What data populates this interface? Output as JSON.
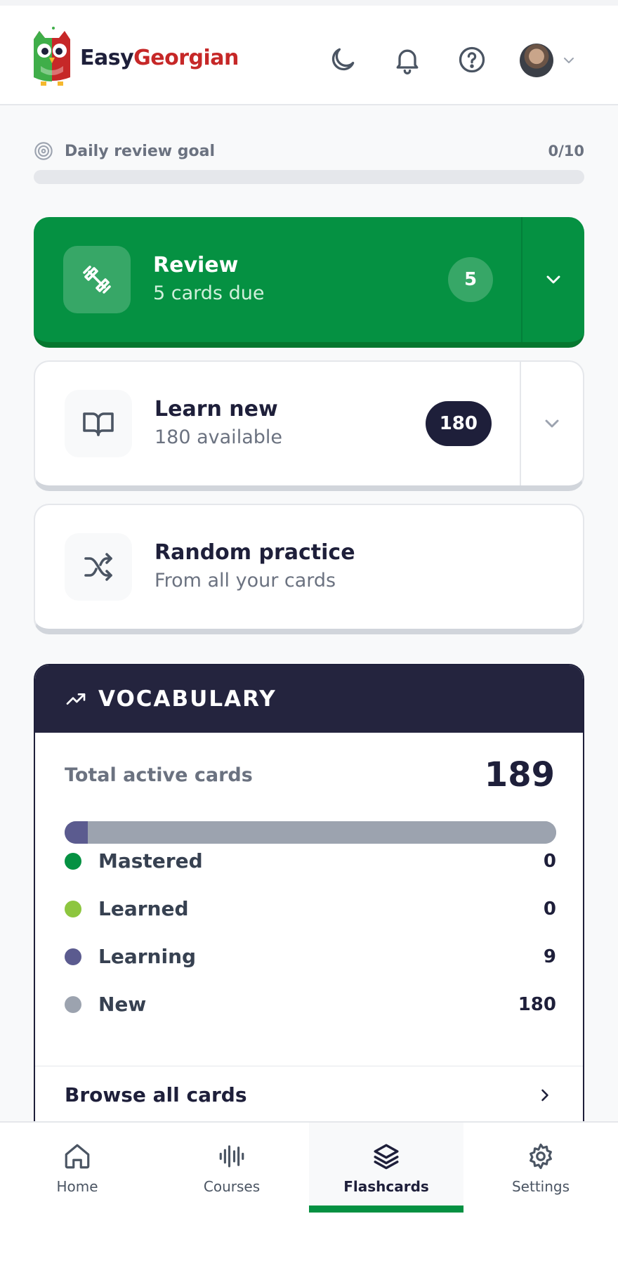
{
  "app": {
    "brand_part1": "Easy",
    "brand_part2": "Georgian",
    "colors": {
      "primary_green": "#059142",
      "navy": "#1e1f3a",
      "brand_red": "#c62828"
    }
  },
  "header": {
    "icons": [
      "moon-icon",
      "bell-icon",
      "help-icon",
      "avatar",
      "chevron-down-icon"
    ]
  },
  "daily_goal": {
    "label": "Daily review goal",
    "count": "0/10",
    "progress": 0
  },
  "actions": {
    "review": {
      "title": "Review",
      "subtitle": "5 cards due",
      "badge": "5"
    },
    "learn": {
      "title": "Learn new",
      "subtitle": "180 available",
      "badge": "180"
    },
    "random": {
      "title": "Random practice",
      "subtitle": "From all your cards"
    }
  },
  "vocabulary": {
    "title": "VOCABULARY",
    "total_label": "Total active cards",
    "total_value": "189",
    "stats": [
      {
        "label": "Mastered",
        "value": "0",
        "count": 0,
        "color": "#059142"
      },
      {
        "label": "Learned",
        "value": "0",
        "count": 0,
        "color": "#8dc63f"
      },
      {
        "label": "Learning",
        "value": "9",
        "count": 9,
        "color": "#5b5b8f"
      },
      {
        "label": "New",
        "value": "180",
        "count": 180,
        "color": "#9ca3af"
      }
    ],
    "browse_label": "Browse all cards"
  },
  "nav": {
    "items": [
      {
        "label": "Home",
        "icon": "home-icon",
        "active": false
      },
      {
        "label": "Courses",
        "icon": "soundwave-icon",
        "active": false
      },
      {
        "label": "Flashcards",
        "icon": "layers-icon",
        "active": true
      },
      {
        "label": "Settings",
        "icon": "gear-icon",
        "active": false
      }
    ]
  }
}
